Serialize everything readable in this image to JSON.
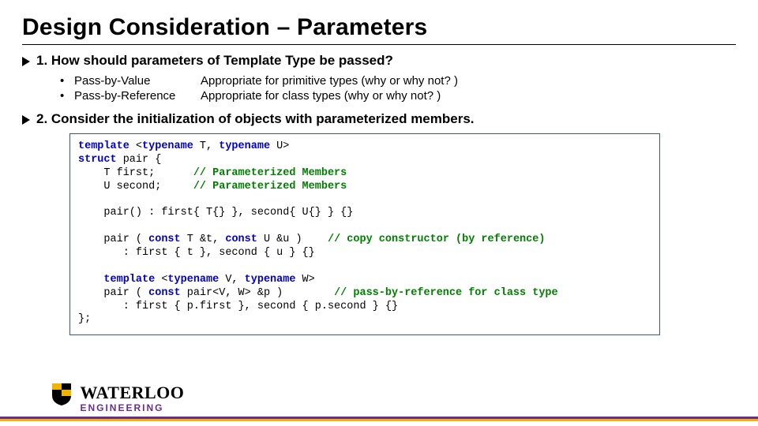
{
  "title": "Design Consideration – Parameters",
  "q1": "1. How should parameters of Template Type be passed?",
  "p1_label": "Pass-by-Value",
  "p1_desc": "Appropriate for primitive types (why or why not? )",
  "p2_label": "Pass-by-Reference",
  "p2_desc": "Appropriate for class types (why or why not? )",
  "q2": "2. Consider the initialization of objects with parameterized members.",
  "code": {
    "l01a": "template",
    "l01b": " <",
    "l01c": "typename",
    "l01d": " T, ",
    "l01e": "typename",
    "l01f": " U>",
    "l02a": "struct",
    "l02b": " pair {",
    "l03a": "    T first;      ",
    "l03b": "// Parameterized Members",
    "l04a": "    U second;     ",
    "l04b": "// Parameterized Members",
    "l06": "    pair() : first{ T{} }, second{ U{} } {}",
    "l08a": "    pair ( ",
    "l08b": "const",
    "l08c": " T &t, ",
    "l08d": "const",
    "l08e": " U &u )    ",
    "l08f": "// copy constructor (by reference)",
    "l09": "       : first { t }, second { u } {}",
    "l11a": "    ",
    "l11b": "template",
    "l11c": " <",
    "l11d": "typename",
    "l11e": " V, ",
    "l11f": "typename",
    "l11g": " W>",
    "l12a": "    pair ( ",
    "l12b": "const",
    "l12c": " pair<V, W> &p )        ",
    "l12d": "// pass-by-reference for class type",
    "l13": "       : first { p.first }, second { p.second } {}",
    "l14": "};"
  },
  "logo": {
    "name": "WATERLOO",
    "sub": "ENGINEERING"
  }
}
